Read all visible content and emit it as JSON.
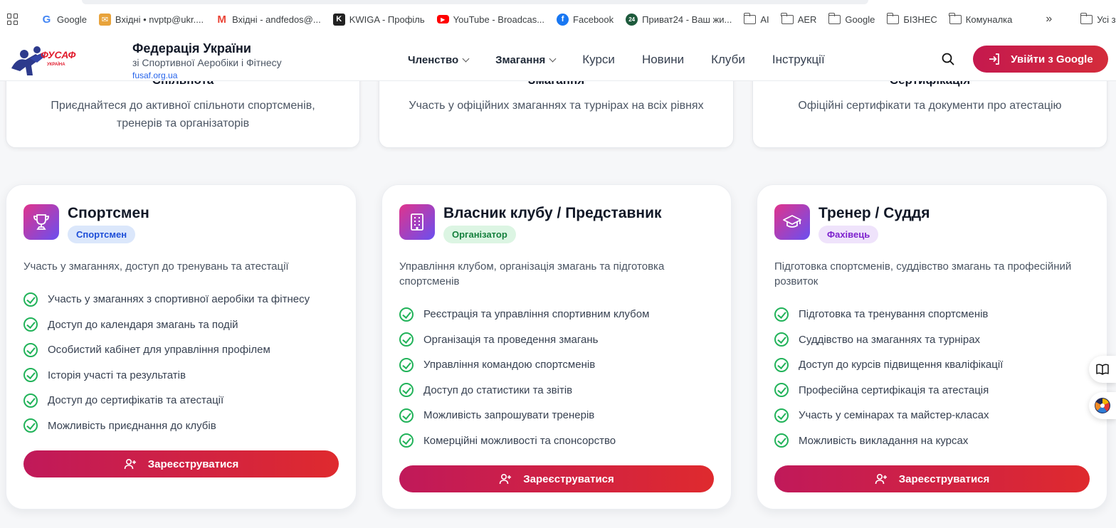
{
  "bookmarks": {
    "items": [
      {
        "label": "Google",
        "icon": "google-icon",
        "color": "#4285f4"
      },
      {
        "label": "Вхідні • nvptp@ukr....",
        "icon": "ukrnet-mail-icon",
        "color": "#e8a33b"
      },
      {
        "label": "Вхідні - andfedos@...",
        "icon": "gmail-icon",
        "color": "#ea4335"
      },
      {
        "label": "KWIGA - Профіль",
        "icon": "kwiga-icon",
        "color": "#222222"
      },
      {
        "label": "YouTube - Broadcas...",
        "icon": "youtube-icon",
        "color": "#ff0000"
      },
      {
        "label": "Facebook",
        "icon": "facebook-icon",
        "color": "#1877f2"
      },
      {
        "label": "Приват24 - Ваш жи...",
        "icon": "privat24-icon",
        "color": "#1e5a3c"
      },
      {
        "label": "AI",
        "icon": "folder-icon"
      },
      {
        "label": "AER",
        "icon": "folder-icon"
      },
      {
        "label": "Google",
        "icon": "folder-icon"
      },
      {
        "label": "БІЗНЕС",
        "icon": "folder-icon"
      },
      {
        "label": "Комуналка",
        "icon": "folder-icon"
      }
    ],
    "more_label": "»",
    "all_bookmarks": "Усі закладк"
  },
  "header": {
    "logo_text": "ФУСАФ",
    "logo_sub": "УКРАЇНА",
    "org_name": "Федерація України",
    "org_sub": "зі Спортивної Аеробіки і Фітнесу",
    "org_site": "fusaf.org.ua",
    "nav": [
      {
        "label": "Членство",
        "dropdown": true
      },
      {
        "label": "Змагання",
        "dropdown": true
      },
      {
        "label": "Курси",
        "dropdown": false
      },
      {
        "label": "Новини",
        "dropdown": false
      },
      {
        "label": "Клуби",
        "dropdown": false
      },
      {
        "label": "Інструкції",
        "dropdown": false
      }
    ],
    "login_label": "Увійти з Google"
  },
  "top_cards": [
    {
      "title": "Спільнота",
      "desc": "Приєднайтеся до активної спільноти спортсменів, тренерів та організаторів"
    },
    {
      "title": "Змагання",
      "desc": "Участь у офіційних змаганнях та турнірах на всіх рівнях"
    },
    {
      "title": "Сертифікація",
      "desc": "Офіційні сертифікати та документи про атестацію"
    }
  ],
  "roles": [
    {
      "title": "Спортсмен",
      "badge": "Спортсмен",
      "badge_bg": "#dbe7fb",
      "badge_color": "#1d4ed8",
      "icon": "trophy-icon",
      "desc": "Участь у змаганнях, доступ до тренувань та атестації",
      "features": [
        "Участь у змаганнях з спортивної аеробіки та фітнесу",
        "Доступ до календаря змагань та подій",
        "Особистий кабінет для управління профілем",
        "Історія участі та результатів",
        "Доступ до сертифікатів та атестації",
        "Можливість приєднання до клубів"
      ],
      "button": "Зареєструватися"
    },
    {
      "title": "Власник клубу / Представник",
      "badge": "Організатор",
      "badge_bg": "#dcf5e3",
      "badge_color": "#15803d",
      "icon": "building-icon",
      "desc": "Управління клубом, організація змагань та підготовка спортсменів",
      "features": [
        "Реєстрація та управління спортивним клубом",
        "Організація та проведення змагань",
        "Управління командою спортсменів",
        "Доступ до статистики та звітів",
        "Можливість запрошувати тренерів",
        "Комерційні можливості та спонсорство"
      ],
      "button": "Зареєструватися"
    },
    {
      "title": "Тренер / Суддя",
      "badge": "Фахівець",
      "badge_bg": "#efe3fb",
      "badge_color": "#7e22ce",
      "icon": "graduation-cap-icon",
      "desc": "Підготовка спортсменів, суддівство змагань та професійний розвиток",
      "features": [
        "Підготовка та тренування спортсменів",
        "Суддівство на змаганнях та турнірах",
        "Доступ до курсів підвищення кваліфікації",
        "Професійна сертифікація та атестація",
        "Участь у семінарах та майстер-класах",
        "Можливість викладання на курсах"
      ],
      "button": "Зареєструватися"
    }
  ],
  "colors": {
    "accent_start": "#c0195a",
    "accent_end": "#df2a2e",
    "check": "#22b35a"
  }
}
